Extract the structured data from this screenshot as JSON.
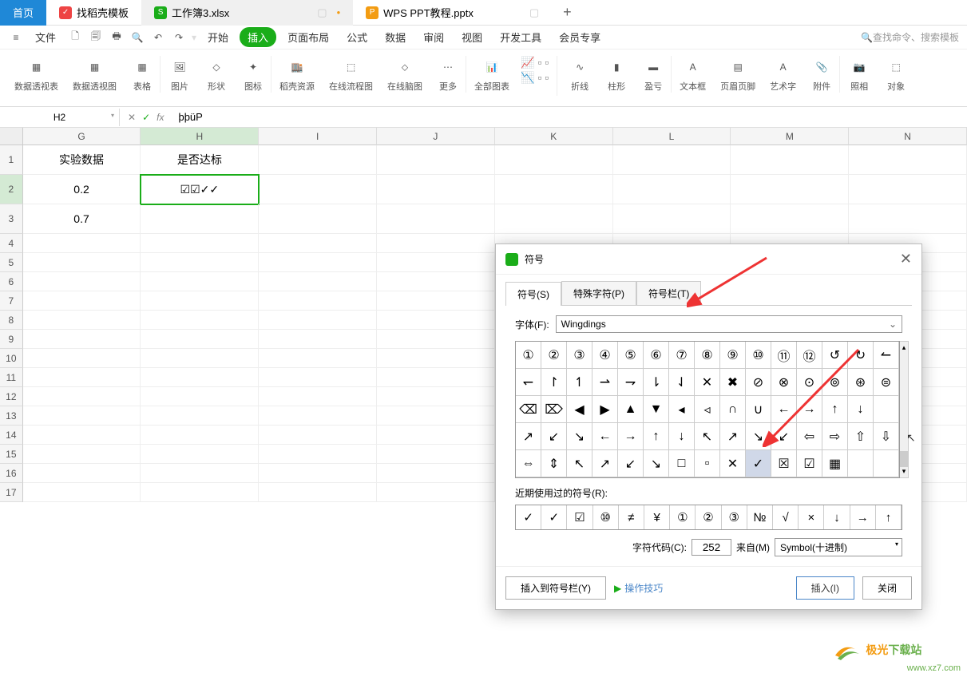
{
  "tabs": {
    "home": "首页",
    "docer": "找稻壳模板",
    "file1": "工作簿3.xlsx",
    "file2": "WPS PPT教程.pptx",
    "add": "+"
  },
  "menubar": {
    "file": "文件",
    "items": [
      "开始",
      "插入",
      "页面布局",
      "公式",
      "数据",
      "审阅",
      "视图",
      "开发工具",
      "会员专享"
    ],
    "search_placeholder": "查找命令、搜索模板"
  },
  "ribbon": {
    "g1": "数据透视表",
    "g2": "数据透视图",
    "g3": "表格",
    "g4": "图片",
    "g5": "形状",
    "g6": "图标",
    "g7": "稻壳资源",
    "g8": "在线流程图",
    "g9": "在线脑图",
    "g10": "更多",
    "g11": "全部图表",
    "g12": "折线",
    "g13": "柱形",
    "g14": "盈亏",
    "g15": "文本框",
    "g16": "页眉页脚",
    "g17": "艺术字",
    "g18": "附件",
    "g19": "照相",
    "g20": "对象"
  },
  "formula": {
    "cell_ref": "H2",
    "fx": "fx",
    "value": "þþüP"
  },
  "columns": [
    "G",
    "H",
    "I",
    "J",
    "K",
    "L",
    "M",
    "N"
  ],
  "rows_data": {
    "headers": {
      "g": "实验数据",
      "h": "是否达标"
    },
    "r2": {
      "g": "0.2",
      "h": "☑☑✓✓"
    },
    "r3": {
      "g": "0.7",
      "h": ""
    }
  },
  "dialog": {
    "title": "符号",
    "tabs": [
      "符号(S)",
      "特殊字符(P)",
      "符号栏(T)"
    ],
    "font_label": "字体(F):",
    "font_value": "Wingdings",
    "symbols": [
      [
        "①",
        "②",
        "③",
        "④",
        "⑤",
        "⑥",
        "⑦",
        "⑧",
        "⑨",
        "⑩",
        "⑪",
        "⑫",
        "↺",
        "↻",
        "↼"
      ],
      [
        "↽",
        "↾",
        "↿",
        "⇀",
        "⇁",
        "⇂",
        "⇃",
        "✕",
        "✖",
        "⊘",
        "⊗",
        "⊙",
        "⊚",
        "⊛",
        "⊜"
      ],
      [
        "⌫",
        "⌦",
        "◀",
        "▶",
        "▲",
        "▼",
        "◂",
        "◃",
        "∩",
        "∪",
        "←",
        "→",
        "↑",
        "↓",
        " "
      ],
      [
        "↗",
        "↙",
        "↘",
        "←",
        "→",
        "↑",
        "↓",
        "↖",
        "↗",
        "↘",
        "↙",
        "⇦",
        "⇨",
        "⇧",
        "⇩"
      ],
      [
        "⇔",
        "⇕",
        "↖",
        "↗",
        "↙",
        "↘",
        "□",
        "▫",
        "✕",
        "✓",
        "☒",
        "☑",
        "▦",
        " ",
        " "
      ]
    ],
    "selected_row": 4,
    "selected_col": 9,
    "recent_label": "近期使用过的符号(R):",
    "recent": [
      "✓",
      "✓",
      "☑",
      "⑩",
      "≠",
      "¥",
      "①",
      "②",
      "③",
      "№",
      "√",
      "×",
      "↓",
      "→",
      "↑"
    ],
    "code_label": "字符代码(C):",
    "code_value": "252",
    "from_label": "来自(M)",
    "from_value": "Symbol(十进制)",
    "insert_toolbar": "插入到符号栏(Y)",
    "tips": "操作技巧",
    "insert_btn": "插入(I)",
    "close_btn": "关闭"
  },
  "watermark": {
    "brand1": "极光",
    "brand2": "下载站",
    "url": "www.xz7.com"
  }
}
